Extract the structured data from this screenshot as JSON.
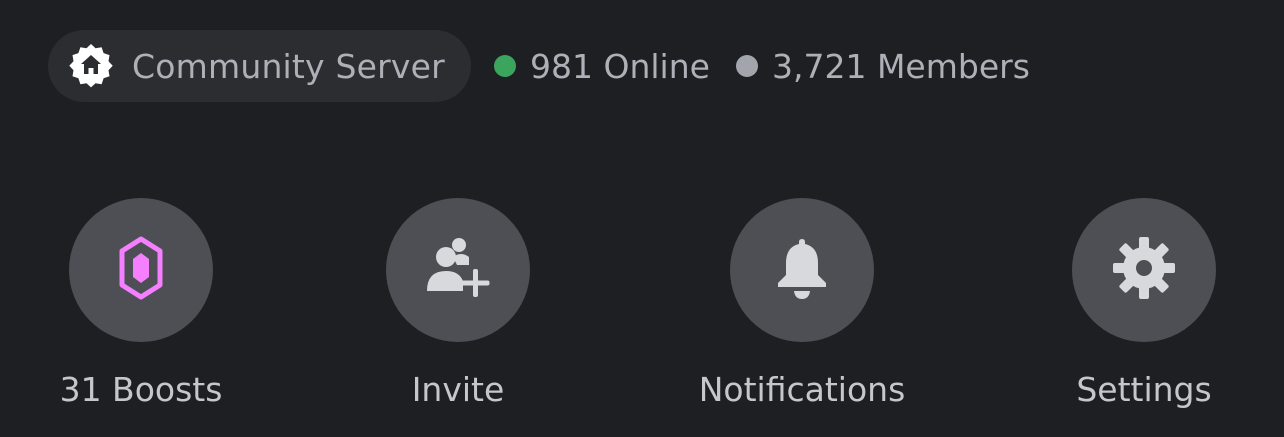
{
  "server": {
    "name": "Community Server",
    "icon": "community-server-home-badge-icon"
  },
  "stats": {
    "online": "981 Online",
    "online_color": "#3ba55d",
    "members": "3,721 Members",
    "members_color": "#a3a5ad"
  },
  "actions": [
    {
      "label": "31 Boosts",
      "icon": "boost-gem-icon",
      "accent": "#f47fff"
    },
    {
      "label": "Invite",
      "icon": "add-user-icon"
    },
    {
      "label": "Notifications",
      "icon": "bell-icon"
    },
    {
      "label": "Settings",
      "icon": "gear-icon"
    }
  ],
  "colors": {
    "background": "#1e1f23",
    "pill": "#2b2d31",
    "button": "#4e4f54",
    "icon": "#d8d9dd"
  }
}
